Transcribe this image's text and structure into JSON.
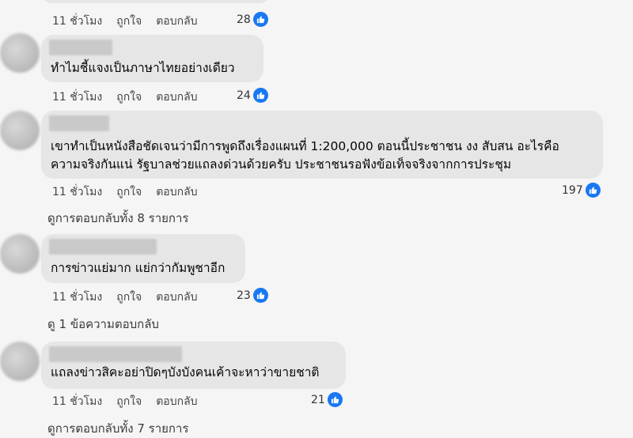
{
  "meta_labels": {
    "time": "11 ชั่วโมง",
    "like": "ถูกใจ",
    "reply": "ตอบกลับ"
  },
  "top_reaction": "28",
  "comments": [
    {
      "text": "ทำไมชี้แจงเป็นภาษาไทยอย่างเดียว",
      "likes": "24"
    },
    {
      "lines": [
        "เขาทำเป็นหนังสือชัดเจนว่ามีการพูดถึงเรื่องแผนที่ 1:200,000 ตอนนี้ประชาชน งง สับสน อะไรคือ",
        "ความจริงกันแน่ รัฐบาลช่วยแถลงด่วนด้วยครับ ประชาชนรอฟังข้อเท็จจริงจากการประชุม"
      ],
      "likes": "197",
      "replies_link": "ดูการตอบกลับทั้ง 8 รายการ"
    },
    {
      "text": "การข่าวแย่มาก แย่กว่ากัมพูชาอีก",
      "likes": "23",
      "replies_link": "ดู 1 ข้อความตอบกลับ"
    },
    {
      "text": "แถลงข่าวสิคะอย่าปิดๆบังบังคนเค้าจะหาว่าขายชาติ",
      "likes": "21",
      "replies_link": "ดูการตอบกลับทั้ง 7 รายการ"
    }
  ],
  "colors": {
    "like_blue": "#1877f2",
    "bubble": "#e6e6e6"
  },
  "icons": {
    "like": "thumbs-up-icon"
  }
}
